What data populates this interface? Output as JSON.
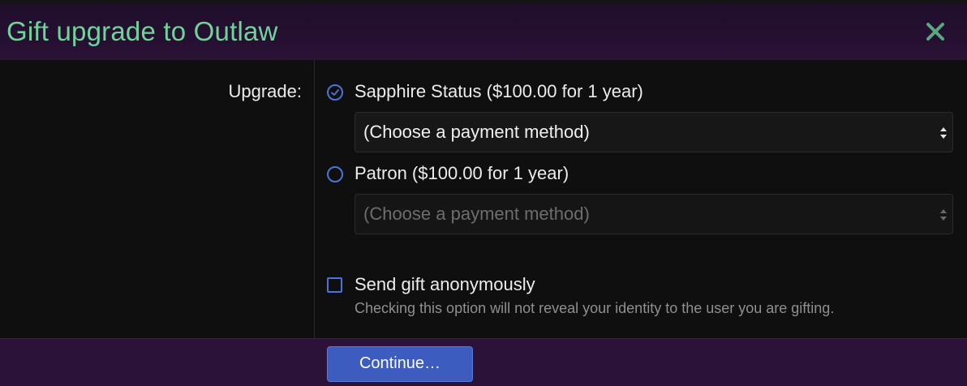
{
  "dialog": {
    "title": "Gift upgrade to Outlaw"
  },
  "form": {
    "upgrade_label": "Upgrade:",
    "options": [
      {
        "label": "Sapphire Status ($100.00 for 1 year)",
        "selected": true,
        "payment_select": {
          "value": "(Choose a payment method)",
          "disabled": false
        }
      },
      {
        "label": "Patron ($100.00 for 1 year)",
        "selected": false,
        "payment_select": {
          "value": "(Choose a payment method)",
          "disabled": true
        }
      }
    ],
    "anonymous": {
      "label": "Send gift anonymously",
      "hint": "Checking this option will not reveal your identity to the user you are gifting.",
      "checked": false
    }
  },
  "footer": {
    "continue_label": "Continue…"
  },
  "colors": {
    "title": "#6fd49a",
    "accent": "#4b74d6",
    "button": "#3d5cbf",
    "header_bg": "#2a1236"
  },
  "icons": {
    "close": "close-icon",
    "radio_checked": "check-circle-icon",
    "select_arrows": "sort-arrows-icon"
  }
}
